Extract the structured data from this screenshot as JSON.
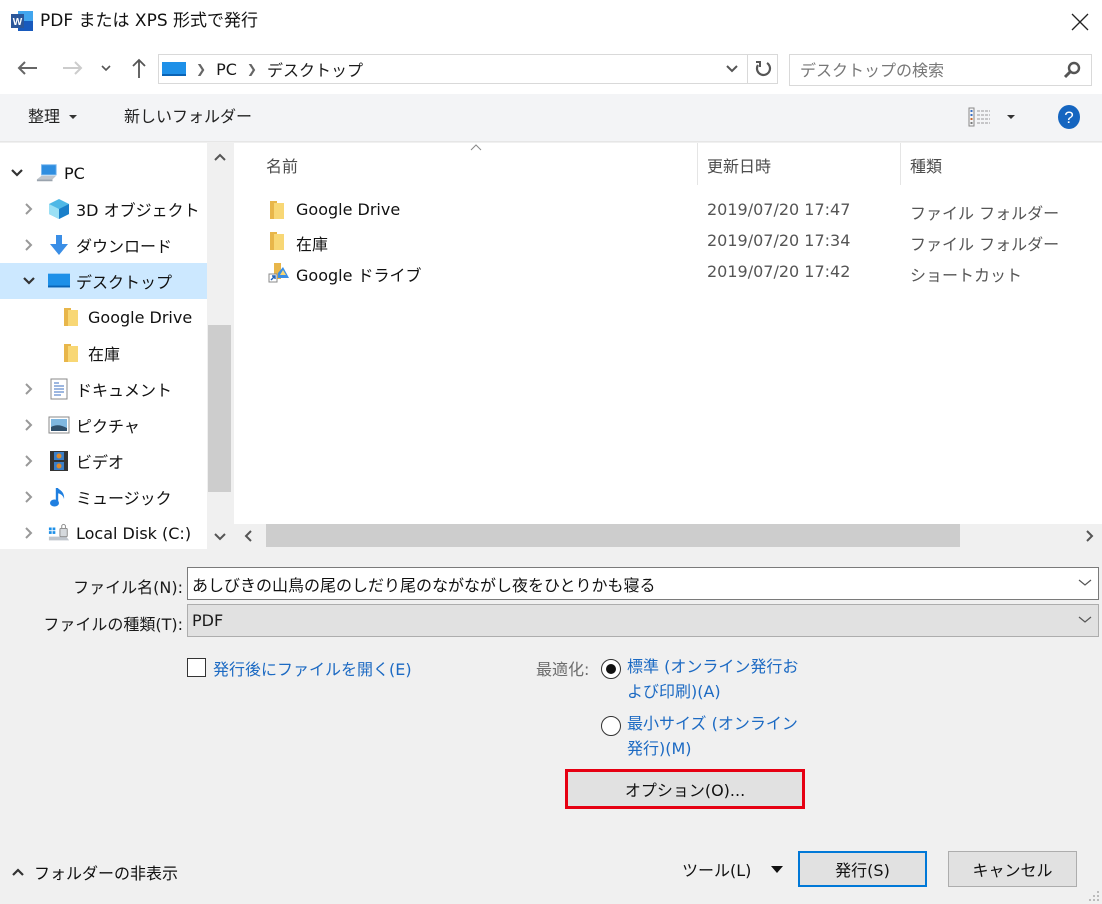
{
  "window": {
    "title": "PDF または XPS 形式で発行",
    "app_icon": "word-icon"
  },
  "nav": {
    "breadcrumb": [
      "PC",
      "デスクトップ"
    ],
    "search_placeholder": "デスクトップの検索"
  },
  "commandbar": {
    "organize_label": "整理",
    "new_folder_label": "新しいフォルダー"
  },
  "tree": {
    "items": [
      {
        "label": "PC",
        "icon": "pc-icon",
        "chevron": "expanded",
        "level": 0,
        "selected": false
      },
      {
        "label": "3D オブジェクト",
        "icon": "3d-objects-icon",
        "chevron": "collapsed",
        "level": 1,
        "selected": false
      },
      {
        "label": "ダウンロード",
        "icon": "download-icon",
        "chevron": "collapsed",
        "level": 1,
        "selected": false
      },
      {
        "label": "デスクトップ",
        "icon": "desktop-icon",
        "chevron": "expanded",
        "level": 1,
        "selected": true
      },
      {
        "label": "Google Drive",
        "icon": "folder-icon",
        "chevron": "none",
        "level": 2,
        "selected": false
      },
      {
        "label": "在庫",
        "icon": "folder-icon",
        "chevron": "none",
        "level": 2,
        "selected": false
      },
      {
        "label": "ドキュメント",
        "icon": "documents-icon",
        "chevron": "collapsed",
        "level": 1,
        "selected": false
      },
      {
        "label": "ピクチャ",
        "icon": "pictures-icon",
        "chevron": "collapsed",
        "level": 1,
        "selected": false
      },
      {
        "label": "ビデオ",
        "icon": "videos-icon",
        "chevron": "collapsed",
        "level": 1,
        "selected": false
      },
      {
        "label": "ミュージック",
        "icon": "music-icon",
        "chevron": "collapsed",
        "level": 1,
        "selected": false
      },
      {
        "label": "Local Disk (C:)",
        "icon": "local-disk-icon",
        "chevron": "collapsed",
        "level": 1,
        "selected": false
      }
    ]
  },
  "filelist": {
    "columns": {
      "name": "名前",
      "date": "更新日時",
      "type": "種類"
    },
    "rows": [
      {
        "name": "Google Drive",
        "date": "2019/07/20 17:47",
        "type": "ファイル フォルダー",
        "icon": "folder-icon"
      },
      {
        "name": "在庫",
        "date": "2019/07/20 17:34",
        "type": "ファイル フォルダー",
        "icon": "folder-icon"
      },
      {
        "name": "Google ドライブ",
        "date": "2019/07/20 17:42",
        "type": "ショートカット",
        "icon": "shortcut-icon"
      }
    ]
  },
  "form": {
    "filename_label": "ファイル名(N):",
    "filename_value": "あしびきの山鳥の尾のしだり尾のながながし夜をひとりかも寝る",
    "filetype_label": "ファイルの種類(T):",
    "filetype_value": "PDF",
    "open_after_label": "発行後にファイルを開く(E)",
    "open_after_checked": false,
    "optimize_label": "最適化:",
    "optimize_options": [
      {
        "label": "標準 (オンライン発行および印刷)(A)",
        "selected": true
      },
      {
        "label": "最小サイズ (オンライン発行)(M)",
        "selected": false
      }
    ],
    "options_button": "オプション(O)..."
  },
  "footer": {
    "hide_folders_label": "フォルダーの非表示",
    "tools_label": "ツール(L)",
    "publish_label": "発行(S)",
    "cancel_label": "キャンセル"
  },
  "colors": {
    "selection": "#cce8ff",
    "accent": "#0078d7",
    "link": "#1c6ac3",
    "highlight_box": "#e60012"
  }
}
